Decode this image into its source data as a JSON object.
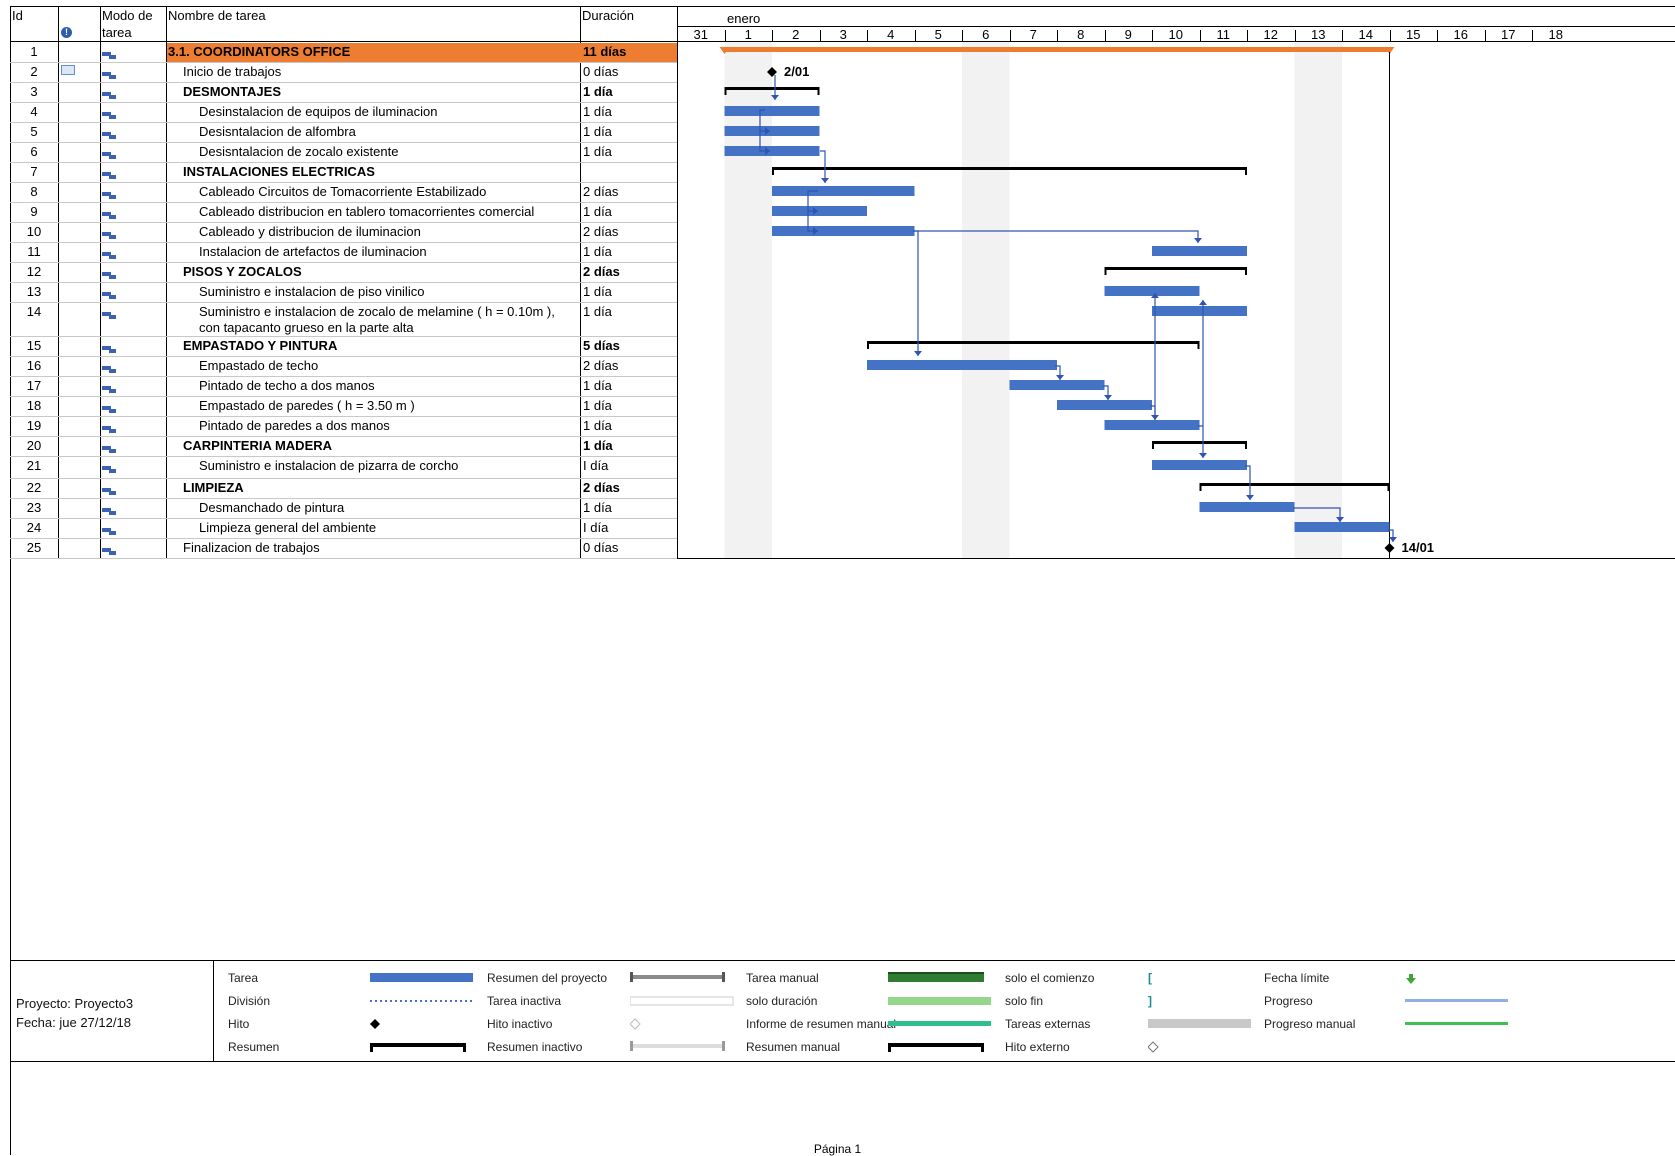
{
  "table": {
    "headers": {
      "id": "Id",
      "mode_line1": "Modo de",
      "mode_line2": "tarea",
      "name": "Nombre de tarea",
      "duration": "Duración"
    },
    "rows": [
      {
        "id": "1",
        "name": "3.1. COORDINATORS OFFICE",
        "duration": "11 días",
        "level": 0,
        "summary": true,
        "highlight": true
      },
      {
        "id": "2",
        "name": "Inicio de trabajos",
        "duration": "0 días",
        "level": 1,
        "summary": false,
        "note": true
      },
      {
        "id": "3",
        "name": "DESMONTAJES",
        "duration": "1 día",
        "level": 1,
        "summary": true
      },
      {
        "id": "4",
        "name": "Desinstalacion de equipos de iluminacion",
        "duration": "1 día",
        "level": 2,
        "summary": false
      },
      {
        "id": "5",
        "name": "Desisntalacion de alfombra",
        "duration": "1 día",
        "level": 2,
        "summary": false
      },
      {
        "id": "6",
        "name": "Desisntalacion de zocalo existente",
        "duration": "1 día",
        "level": 2,
        "summary": false
      },
      {
        "id": "7",
        "name": "INSTALACIONES ELECTRICAS",
        "duration": "",
        "level": 1,
        "summary": true
      },
      {
        "id": "8",
        "name": "Cableado Circuitos de Tomacorriente Estabilizado",
        "duration": "2 días",
        "level": 2,
        "summary": false
      },
      {
        "id": "9",
        "name": "Cableado distribucion en tablero tomacorrientes comercial",
        "duration": "1 día",
        "level": 2,
        "summary": false
      },
      {
        "id": "10",
        "name": "Cableado y distribucion de iluminacion",
        "duration": "2 días",
        "level": 2,
        "summary": false
      },
      {
        "id": "11",
        "name": "Instalacion de artefactos de iluminacion",
        "duration": "1 día",
        "level": 2,
        "summary": false
      },
      {
        "id": "12",
        "name": "PISOS Y ZOCALOS",
        "duration": "2 días",
        "level": 1,
        "summary": true
      },
      {
        "id": "13",
        "name": "Suministro e instalacion de piso vinilico",
        "duration": "1 día",
        "level": 2,
        "summary": false
      },
      {
        "id": "14",
        "name": "Suministro e instalacion de zocalo de melamine ( h = 0.10m ),",
        "name2": "con tapacanto grueso en la parte alta",
        "duration": "1 día",
        "level": 2,
        "summary": false
      },
      {
        "id": "15",
        "name": "EMPASTADO Y PINTURA",
        "duration": "5 días",
        "level": 1,
        "summary": true
      },
      {
        "id": "16",
        "name": "Empastado de techo",
        "duration": "2 días",
        "level": 2,
        "summary": false
      },
      {
        "id": "17",
        "name": "Pintado de techo a dos manos",
        "duration": "1 día",
        "level": 2,
        "summary": false
      },
      {
        "id": "18",
        "name": "Empastado de paredes ( h = 3.50 m )",
        "duration": "1 día",
        "level": 2,
        "summary": false
      },
      {
        "id": "19",
        "name": "Pintado de paredes a dos manos",
        "duration": "1 día",
        "level": 2,
        "summary": false
      },
      {
        "id": "20",
        "name": "CARPINTERIA MADERA",
        "duration": "1 día",
        "level": 1,
        "summary": true
      },
      {
        "id": "21",
        "name": "Suministro e instalacion de pizarra de corcho",
        "duration": "I día",
        "level": 2,
        "summary": false
      },
      {
        "id": "22",
        "name": "LIMPIEZA",
        "duration": "2 días",
        "level": 1,
        "summary": true
      },
      {
        "id": "23",
        "name": "Desmanchado de pintura",
        "duration": "1 día",
        "level": 2,
        "summary": false
      },
      {
        "id": "24",
        "name": "Limpieza general del ambiente",
        "duration": "I día",
        "level": 2,
        "summary": false
      },
      {
        "id": "25",
        "name": "Finalizacion de trabajos",
        "duration": "0 días",
        "level": 1,
        "summary": false
      }
    ]
  },
  "timeline": {
    "month": "enero",
    "days": [
      "31",
      "1",
      "2",
      "3",
      "4",
      "5",
      "6",
      "7",
      "8",
      "9",
      "10",
      "11",
      "12",
      "13",
      "14",
      "15",
      "16",
      "17",
      "18"
    ],
    "weekend_day_index": [
      1,
      6,
      13
    ],
    "milestone_labels": {
      "start": "2/01",
      "end": "14/01"
    }
  },
  "gantt": {
    "project_summary": {
      "start": 1,
      "end": 14
    },
    "summaries": [
      {
        "row": 3,
        "start": 1,
        "end": 2
      },
      {
        "row": 7,
        "start": 2,
        "end": 11
      },
      {
        "row": 12,
        "start": 9,
        "end": 11
      },
      {
        "row": 15,
        "start": 4,
        "end": 10
      },
      {
        "row": 20,
        "start": 10,
        "end": 11
      },
      {
        "row": 22,
        "start": 11,
        "end": 14
      }
    ],
    "tasks": [
      {
        "row": 4,
        "start": 1,
        "end": 2
      },
      {
        "row": 5,
        "start": 1,
        "end": 2
      },
      {
        "row": 6,
        "start": 1,
        "end": 2
      },
      {
        "row": 8,
        "start": 2,
        "end": 4
      },
      {
        "row": 9,
        "start": 2,
        "end": 3
      },
      {
        "row": 10,
        "start": 2,
        "end": 4
      },
      {
        "row": 11,
        "start": 10,
        "end": 11
      },
      {
        "row": 13,
        "start": 9,
        "end": 10
      },
      {
        "row": 14,
        "start": 10,
        "end": 11
      },
      {
        "row": 16,
        "start": 4,
        "end": 7
      },
      {
        "row": 17,
        "start": 7,
        "end": 8
      },
      {
        "row": 18,
        "start": 8,
        "end": 9
      },
      {
        "row": 19,
        "start": 9,
        "end": 10
      },
      {
        "row": 21,
        "start": 10,
        "end": 11
      },
      {
        "row": 23,
        "start": 11,
        "end": 12
      },
      {
        "row": 24,
        "start": 13,
        "end": 14
      }
    ],
    "milestones": [
      {
        "row": 2,
        "at": 1,
        "label_key": "start"
      },
      {
        "row": 25,
        "at": 14,
        "label_key": "end"
      }
    ]
  },
  "colors": {
    "task": "#4472c4",
    "summary": "#000000",
    "project": "#ed7d31",
    "weekend": "#f2f2f2",
    "link": "#2f54b5"
  },
  "footer": {
    "project_label": "Proyecto: Proyecto3",
    "date_label": "Fecha: jue 27/12/18",
    "page_label": "Página 1",
    "legend": [
      [
        "Tarea",
        "Resumen del proyecto",
        "Tarea manual",
        "solo el comienzo",
        "Fecha límite"
      ],
      [
        "División",
        "Tarea inactiva",
        "solo duración",
        "solo fin",
        "Progreso"
      ],
      [
        "Hito",
        "Hito inactivo",
        "Informe de resumen manual",
        "Tareas externas",
        "Progreso manual"
      ],
      [
        "Resumen",
        "Resumen inactivo",
        "Resumen manual",
        "Hito externo",
        ""
      ]
    ]
  }
}
